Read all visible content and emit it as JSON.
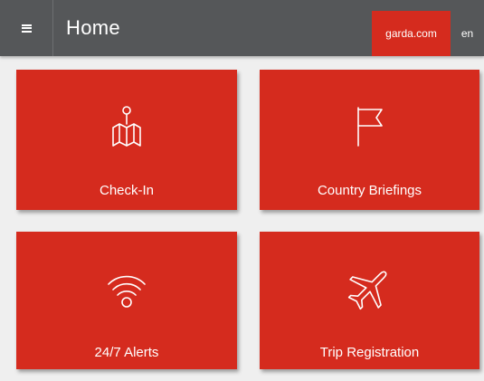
{
  "header": {
    "title": "Home",
    "site_link": "garda.com",
    "language": "en"
  },
  "tiles": [
    {
      "label": "Check-In",
      "icon": "map-pin-icon"
    },
    {
      "label": "Country Briefings",
      "icon": "flag-icon"
    },
    {
      "label": "24/7 Alerts",
      "icon": "wifi-signal-icon"
    },
    {
      "label": "Trip Registration",
      "icon": "airplane-icon"
    }
  ],
  "colors": {
    "header_bg": "#555759",
    "accent": "#d52b1e",
    "page_bg": "#efefef",
    "text": "#ffffff"
  }
}
